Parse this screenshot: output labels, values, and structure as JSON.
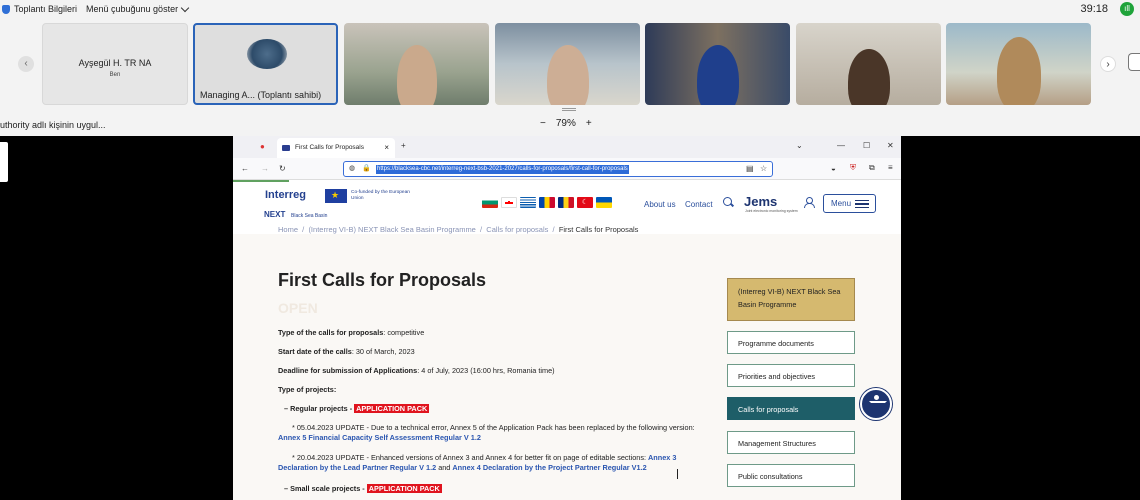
{
  "meeting": {
    "info_label": "Toplantı Bilgileri",
    "menu_bar_label": "Menü çubuğunu göster",
    "timer": "39:18",
    "signal_badge": "ıll",
    "sharing_text": "uthority adlı kişinin uygul...",
    "zoom_minus": "−",
    "zoom_value": "79%",
    "zoom_plus": "+",
    "prev_arrow": "‹",
    "next_arrow": "›",
    "participants": [
      {
        "name": "Ayşegül H. TR NA",
        "sub": "Ben"
      },
      {
        "name": "Managing A... (Toplantı sahibi)"
      }
    ]
  },
  "browser": {
    "tab_title": "First Calls for Proposals",
    "tab_close": "×",
    "new_tab": "+",
    "url": "https://blacksea-cbc.net/interreg-next-bsb-2021-2027/calls-for-proposals/first-call-for-proposals",
    "window_min": "—",
    "window_max": "☐",
    "window_close": "✕",
    "back": "←",
    "forward": "→",
    "reload": "↻",
    "overflow": "≡"
  },
  "site": {
    "logo_interreg": "Interreg",
    "logo_next": "NEXT",
    "logo_bsb": "Black Sea Basin",
    "eu_text": "Co-funded by the European Union",
    "about": "About us",
    "contact": "Contact",
    "jems": "Jems",
    "jems_sub": "Joint electronic monitoring system",
    "menu": "Menu",
    "flags": [
      "#ffffff|#00966e|#d62612",
      "#ffffff|#ff0000",
      "#0d5eaf|#ffffff",
      "#0046ae|#ffd200|#cc092f",
      "#002b7f|#fcd116|#ce1126",
      "#e30a17",
      "#0057b7|#ffd700"
    ],
    "breadcrumb": [
      "Home",
      "(Interreg VI-B) NEXT Black Sea Basin Programme",
      "Calls for proposals",
      "First Calls for Proposals"
    ],
    "title": "First Calls for Proposals",
    "status": "OPEN",
    "type_label": "Type of the calls for proposals",
    "type_value": ": competitive",
    "start_label": "Start date of the calls",
    "start_value": ": 30 of March, 2023",
    "deadline_label": "Deadline for submission of Applications",
    "deadline_value": ": 4 of July, 2023 (16:00 hrs, Romania time)",
    "projects_label": "Type of projects:",
    "regular_label": "– Regular projects -",
    "application_pack": "APPLICATION PACK",
    "update1_text": "* 05.04.2023 UPDATE - Due to a technical error, Annex 5 of the Application Pack has been replaced by the following version:",
    "update1_link": "Annex 5 Financial Capacity Self Assessment Regular V 1.2",
    "update2_text": "* 20.04.2023 UPDATE - Enhanced versions of Annex 3 and Annex 4 for better fit on page of editable sections:",
    "update2_link1": "Annex 3 Declaration by the Lead Partner Regular V 1.2",
    "update2_and": "and",
    "update2_link2": "Annex 4 Declaration by the Project Partner Regular V1.2",
    "small_label": "– Small scale projects -",
    "sidebar": [
      "(Interreg VI-B) NEXT Black Sea Basin Programme",
      "Programme documents",
      "Priorities and objectives",
      "Calls for proposals",
      "Management Structures",
      "Public consultations"
    ]
  }
}
